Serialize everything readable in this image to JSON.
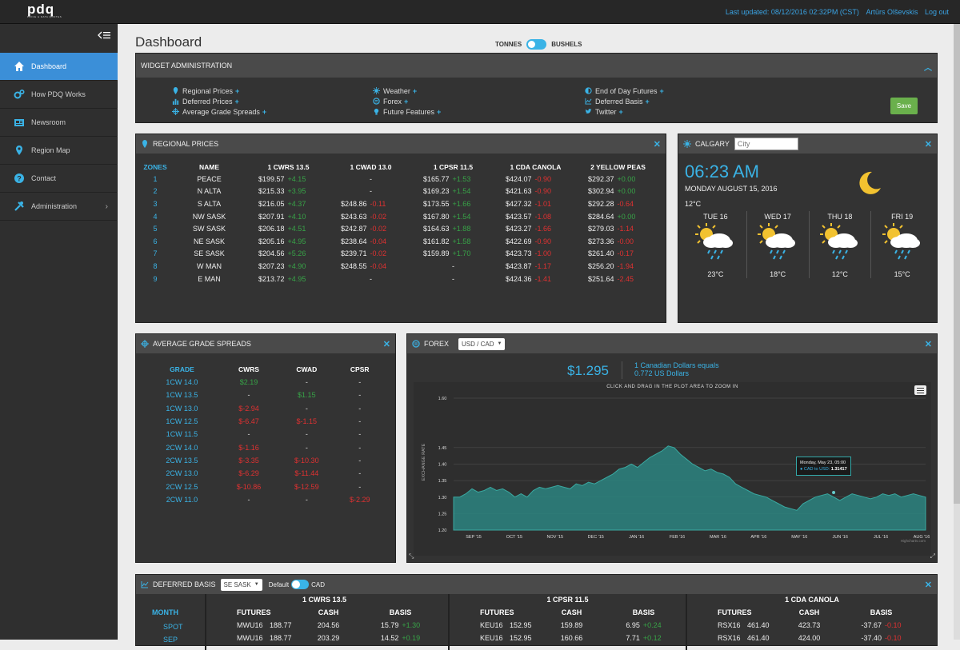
{
  "topbar": {
    "logo_text": "pdq",
    "logo_sub": "PRICE & DATA QUOTES",
    "last_updated": "Last updated: 08/12/2016 02:32PM (CST)",
    "user": "Artūrs Olševskis",
    "logout": "Log out"
  },
  "sidebar": {
    "items": [
      {
        "label": "Dashboard",
        "icon": "home-icon"
      },
      {
        "label": "How PDQ Works",
        "icon": "gears-icon"
      },
      {
        "label": "Newsroom",
        "icon": "newspaper-icon"
      },
      {
        "label": "Region Map",
        "icon": "map-marker-icon"
      },
      {
        "label": "Contact",
        "icon": "question-icon"
      },
      {
        "label": "Administration",
        "icon": "tools-icon"
      }
    ]
  },
  "page": {
    "title": "Dashboard",
    "unit_left": "TONNES",
    "unit_right": "BUSHELS"
  },
  "widget_admin": {
    "title": "WIDGET ADMINISTRATION",
    "col1": [
      "Regional Prices",
      "Deferred Prices",
      "Average Grade Spreads"
    ],
    "col2": [
      "Weather",
      "Forex",
      "Future Features"
    ],
    "col3": [
      "End of Day Futures",
      "Deferred Basis",
      "Twitter"
    ],
    "save_label": "Save"
  },
  "regional_prices": {
    "title": "REGIONAL PRICES",
    "headers": [
      "ZONES",
      "NAME",
      "1 CWRS 13.5",
      "1 CWAD 13.0",
      "1 CPSR 11.5",
      "1 CDA CANOLA",
      "2 YELLOW PEAS"
    ],
    "rows": [
      [
        "1",
        "PEACE",
        "$199.57",
        "+4.15",
        "-",
        "",
        "$165.77",
        "+1.53",
        "$424.07",
        "-0.90",
        "$292.37",
        "+0.00"
      ],
      [
        "2",
        "N ALTA",
        "$215.33",
        "+3.95",
        "-",
        "",
        "$169.23",
        "+1.54",
        "$421.63",
        "-0.90",
        "$302.94",
        "+0.00"
      ],
      [
        "3",
        "S ALTA",
        "$216.05",
        "+4.37",
        "$248.86",
        "-0.11",
        "$173.55",
        "+1.66",
        "$427.32",
        "-1.01",
        "$292.28",
        "-0.64"
      ],
      [
        "4",
        "NW SASK",
        "$207.91",
        "+4.10",
        "$243.63",
        "-0.02",
        "$167.80",
        "+1.54",
        "$423.57",
        "-1.08",
        "$284.64",
        "+0.00"
      ],
      [
        "5",
        "SW SASK",
        "$206.18",
        "+4.51",
        "$242.87",
        "-0.02",
        "$164.63",
        "+1.88",
        "$423.27",
        "-1.66",
        "$279.03",
        "-1.14"
      ],
      [
        "6",
        "NE SASK",
        "$205.16",
        "+4.95",
        "$238.64",
        "-0.04",
        "$161.82",
        "+1.58",
        "$422.69",
        "-0.90",
        "$273.36",
        "-0.00"
      ],
      [
        "7",
        "SE SASK",
        "$204.56",
        "+5.26",
        "$239.71",
        "-0.02",
        "$159.89",
        "+1.70",
        "$423.73",
        "-1.00",
        "$261.40",
        "-0.17"
      ],
      [
        "8",
        "W MAN",
        "$207.23",
        "+4.90",
        "$248.55",
        "-0.04",
        "-",
        "",
        "$423.87",
        "-1.17",
        "$256.20",
        "-1.94"
      ],
      [
        "9",
        "E MAN",
        "$213.72",
        "+4.95",
        "-",
        "",
        "-",
        "",
        "$424.36",
        "-1.41",
        "$251.64",
        "-2.45"
      ]
    ]
  },
  "weather": {
    "title": "CALGARY",
    "city_placeholder": "City",
    "time": "06:23 AM",
    "date": "MONDAY AUGUST 15, 2016",
    "temp": "12°C",
    "days": [
      {
        "name": "TUE 16",
        "temp": "23°C"
      },
      {
        "name": "WED 17",
        "temp": "18°C"
      },
      {
        "name": "THU 18",
        "temp": "12°C"
      },
      {
        "name": "FRI 19",
        "temp": "15°C"
      }
    ]
  },
  "grade_spreads": {
    "title": "AVERAGE GRADE SPREADS",
    "headers": [
      "GRADE",
      "CWRS",
      "CWAD",
      "CPSR"
    ],
    "rows": [
      [
        "1CW 14.0",
        "$2.19",
        "-",
        "-"
      ],
      [
        "1CW 13.5",
        "-",
        "$1.15",
        "-"
      ],
      [
        "1CW 13.0",
        "$-2.94",
        "-",
        "-"
      ],
      [
        "1CW 12.5",
        "$-6.47",
        "$-1.15",
        "-"
      ],
      [
        "1CW 11.5",
        "-",
        "-",
        "-"
      ],
      [
        "2CW 14.0",
        "$-1.16",
        "-",
        "-"
      ],
      [
        "2CW 13.5",
        "$-3.35",
        "$-10.30",
        "-"
      ],
      [
        "2CW 13.0",
        "$-6.29",
        "$-11.44",
        "-"
      ],
      [
        "2CW 12.5",
        "$-10.86",
        "$-12.59",
        "-"
      ],
      [
        "2CW 11.0",
        "-",
        "-",
        "$-2.29"
      ]
    ]
  },
  "forex": {
    "title": "FOREX",
    "pair": "USD / CAD",
    "rate": "$1.295",
    "desc_line1": "1 Canadian Dollars equals",
    "desc_line2": "0.772 US Dollars",
    "hint": "CLICK AND DRAG IN THE PLOT AREA TO ZOOM IN",
    "tooltip_date": "Monday, May 23, 05:00",
    "tooltip_label": "● CAD to USD:",
    "tooltip_value": "1.31417",
    "credit": "Highcharts.com"
  },
  "chart_data": {
    "type": "area",
    "ylabel": "EXCHANGE RATE",
    "ylim": [
      1.2,
      1.6
    ],
    "yticks": [
      "1.60",
      "1.45",
      "1.40",
      "1.35",
      "1.30",
      "1.25",
      "1.20"
    ],
    "xticks": [
      "SEP '15",
      "OCT '15",
      "NOV '15",
      "DEC '15",
      "JAN '16",
      "FEB '16",
      "MAR '16",
      "APR '16",
      "MAY '16",
      "JUN '16",
      "JUL '16",
      "AUG '16"
    ],
    "series": [
      {
        "values": [
          1.3,
          1.3,
          1.31,
          1.325,
          1.315,
          1.32,
          1.33,
          1.32,
          1.325,
          1.315,
          1.3,
          1.31,
          1.3,
          1.32,
          1.33,
          1.325,
          1.33,
          1.335,
          1.33,
          1.325,
          1.34,
          1.335,
          1.345,
          1.34,
          1.35,
          1.36,
          1.37,
          1.385,
          1.39,
          1.4,
          1.39,
          1.405,
          1.42,
          1.43,
          1.44,
          1.455,
          1.45,
          1.43,
          1.415,
          1.4,
          1.39,
          1.38,
          1.385,
          1.375,
          1.37,
          1.36,
          1.34,
          1.33,
          1.32,
          1.31,
          1.305,
          1.3,
          1.29,
          1.28,
          1.27,
          1.265,
          1.26,
          1.28,
          1.29,
          1.3,
          1.305,
          1.31,
          1.3,
          1.29,
          1.3,
          1.31,
          1.305,
          1.3,
          1.295,
          1.3,
          1.31,
          1.305,
          1.31,
          1.3,
          1.305,
          1.31,
          1.305,
          1.3
        ]
      }
    ]
  },
  "deferred_basis": {
    "title": "DEFERRED BASIS",
    "region": "SE SASK",
    "toggle_left": "Default",
    "toggle_right": "CAD",
    "month_header": "MONTH",
    "months": [
      "SPOT",
      "SEP"
    ],
    "groups": [
      {
        "title": "1 CWRS 13.5",
        "headers": [
          "FUTURES",
          "CASH",
          "BASIS"
        ],
        "rows": [
          [
            "MWU16",
            "188.77",
            "204.56",
            "15.79",
            "+1.30"
          ],
          [
            "MWU16",
            "188.77",
            "203.29",
            "14.52",
            "+0.19"
          ]
        ]
      },
      {
        "title": "1 CPSR 11.5",
        "headers": [
          "FUTURES",
          "CASH",
          "BASIS"
        ],
        "rows": [
          [
            "KEU16",
            "152.95",
            "159.89",
            "6.95",
            "+0.24"
          ],
          [
            "KEU16",
            "152.95",
            "160.66",
            "7.71",
            "+0.12"
          ]
        ]
      },
      {
        "title": "1 CDA CANOLA",
        "headers": [
          "FUTURES",
          "CASH",
          "BASIS"
        ],
        "rows": [
          [
            "RSX16",
            "461.40",
            "423.73",
            "-37.67",
            "-0.10"
          ],
          [
            "RSX16",
            "461.40",
            "424.00",
            "-37.40",
            "-0.10"
          ]
        ]
      }
    ]
  },
  "colors": {
    "accent": "#3ab3e6",
    "positive": "#37a447",
    "negative": "#e03131",
    "nav_active": "#3b8fd8",
    "save": "#6ab04c"
  }
}
